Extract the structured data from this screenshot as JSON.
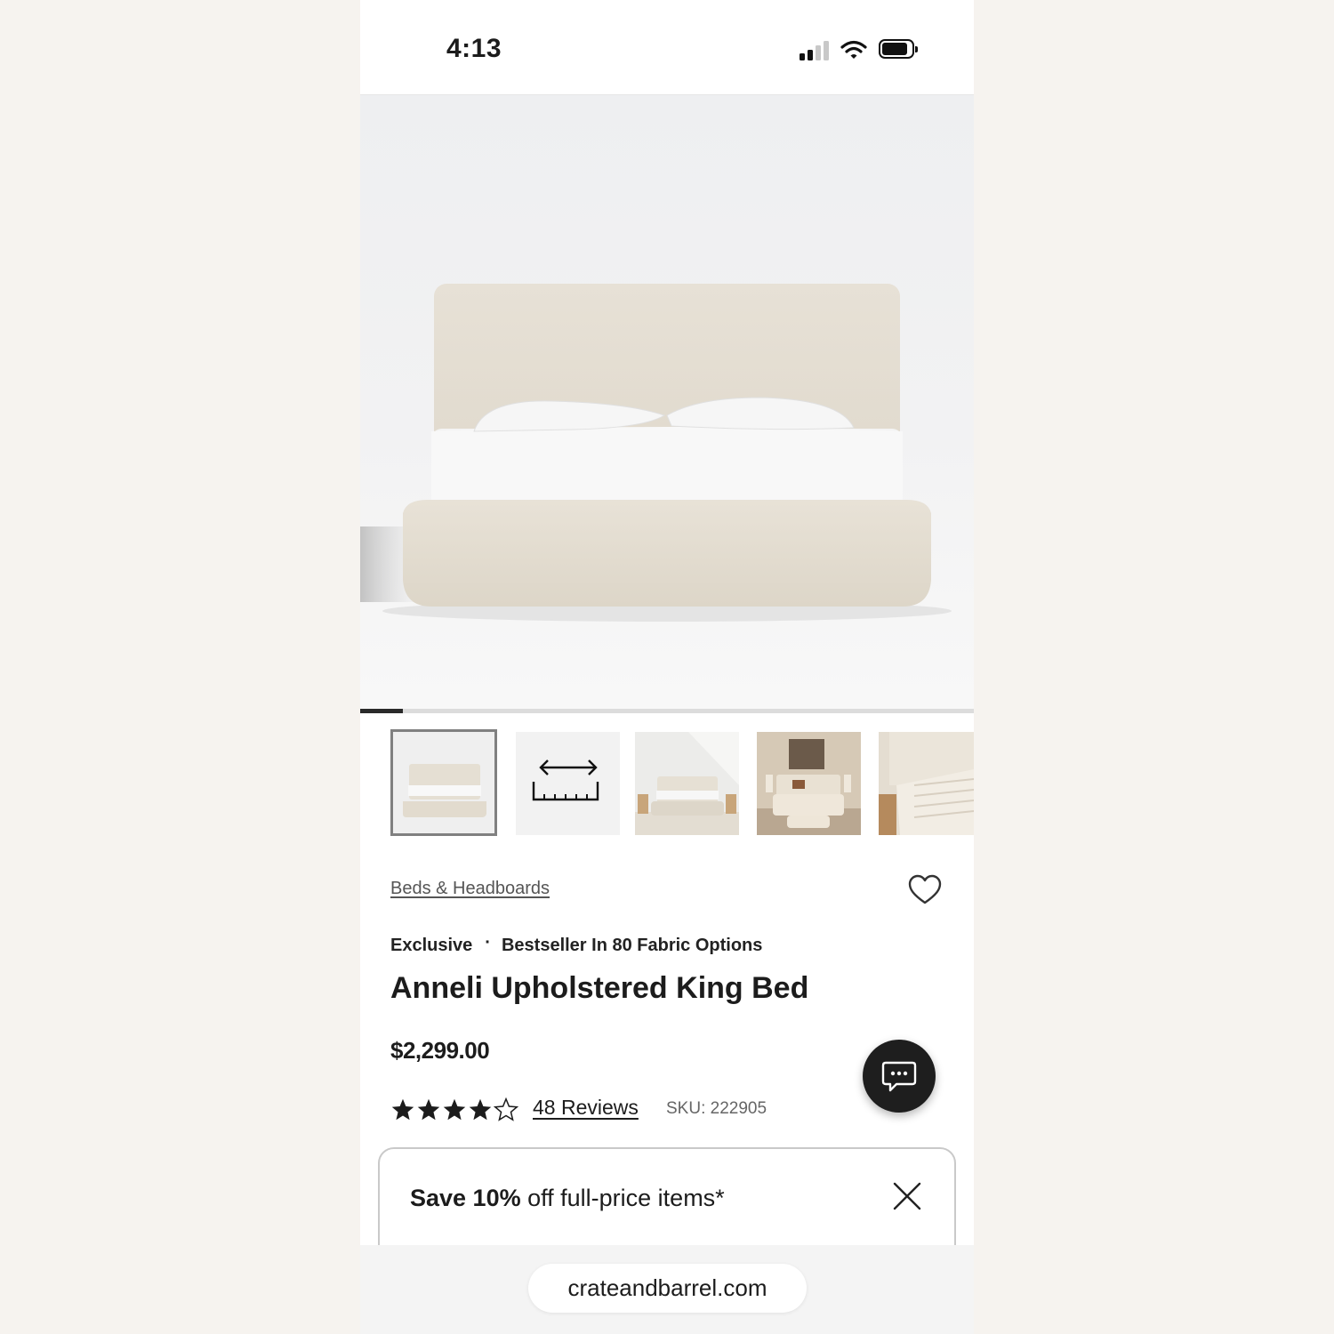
{
  "status_bar": {
    "time": "4:13"
  },
  "gallery": {
    "progress_fraction": 0.07,
    "thumbnails": [
      "bed-front-photo",
      "dimensions-icon",
      "bed-room-photo",
      "bedroom-styled-photo",
      "bed-detail-photo"
    ]
  },
  "product": {
    "category_link": "Beds & Headboards",
    "badge_exclusive": "Exclusive",
    "badge_dot": "·",
    "badge_bestseller": "Bestseller In 80 Fabric Options",
    "title": "Anneli Upholstered King Bed",
    "price": "$2,299.00",
    "rating": 4,
    "rating_max": 5,
    "reviews_label": "48 Reviews",
    "sku": "SKU: 222905"
  },
  "promo": {
    "bold": "Save 10%",
    "rest": " off full-price items*"
  },
  "browser": {
    "url": "crateandbarrel.com"
  },
  "colors": {
    "fabric": "#e6e0d4",
    "dark": "#1e1e1e",
    "page_bg": "#f6f3ef"
  }
}
